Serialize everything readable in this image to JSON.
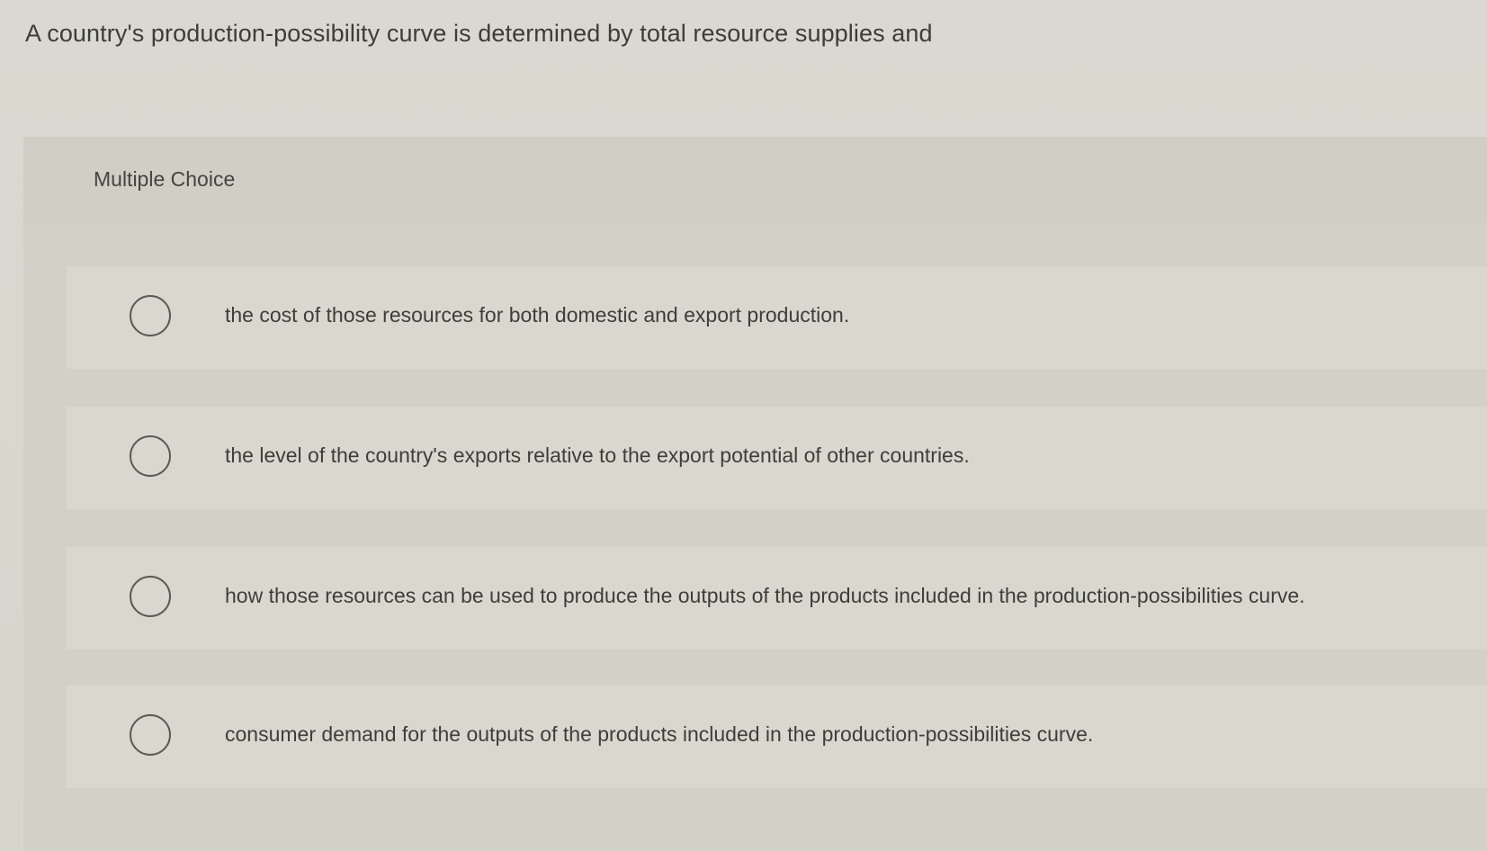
{
  "question": {
    "text": "A country's production-possibility curve is determined by total resource supplies and"
  },
  "multiple_choice": {
    "label": "Multiple Choice",
    "options": [
      {
        "text": "the cost of those resources for both domestic and export production."
      },
      {
        "text": "the level of the country's exports relative to the export potential of other countries."
      },
      {
        "text": "how those resources can be used to produce the outputs of the products included in the production-possibilities curve."
      },
      {
        "text": "consumer demand for the outputs of the products included in the production-possibilities curve."
      }
    ]
  },
  "colors": {
    "background": "#dcdbd3",
    "panel": "#d2d1c8",
    "option_row": "#d9d8cf",
    "text": "#3c3c3a"
  }
}
